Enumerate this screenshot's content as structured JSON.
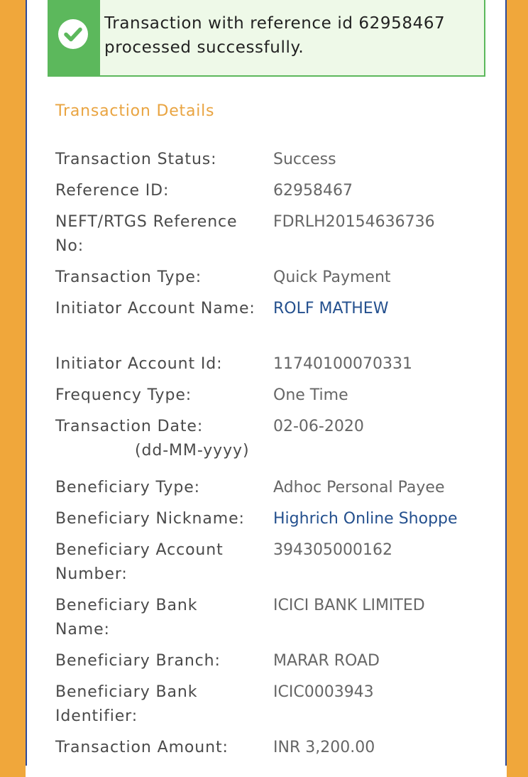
{
  "banner": {
    "message_line1": "Transaction with reference id 62958467",
    "message_line2": "processed successfully.",
    "icon": "check-circle-icon",
    "accent_color": "#5cb85c"
  },
  "section": {
    "title": "Transaction Details"
  },
  "details": [
    {
      "label": "Transaction Status:",
      "value": "Success"
    },
    {
      "label": "Reference ID:",
      "value": "62958467"
    },
    {
      "label": "NEFT/RTGS Reference No:",
      "value": "FDRLH20154636736"
    },
    {
      "label": "Transaction Type:",
      "value": "Quick Payment"
    },
    {
      "label": "Initiator Account Name:",
      "value": "ROLF MATHEW"
    },
    {
      "label": "Initiator Account Id:",
      "value": "11740100070331"
    },
    {
      "label": "Frequency Type:",
      "value": "One Time"
    },
    {
      "label": "Transaction Date:",
      "label_sub": "(dd-MM-yyyy)",
      "value": "02-06-2020"
    },
    {
      "label": "Beneficiary Type:",
      "value": "Adhoc Personal Payee"
    },
    {
      "label": "Beneficiary Nickname:",
      "value": "Highrich Online Shoppe"
    },
    {
      "label": "Beneficiary Account Number:",
      "value": "394305000162"
    },
    {
      "label": "Beneficiary Bank Name:",
      "value": "ICICI BANK LIMITED"
    },
    {
      "label": "Beneficiary Branch:",
      "value": "MARAR ROAD"
    },
    {
      "label": "Beneficiary Bank Identifier:",
      "value": "ICIC0003943"
    },
    {
      "label": "Transaction Amount:",
      "value": "INR 3,200.00"
    }
  ],
  "colors": {
    "frame": "#f0a73b",
    "border": "#2d4a9a",
    "section_title": "#e9a441",
    "link": "#24508e"
  }
}
